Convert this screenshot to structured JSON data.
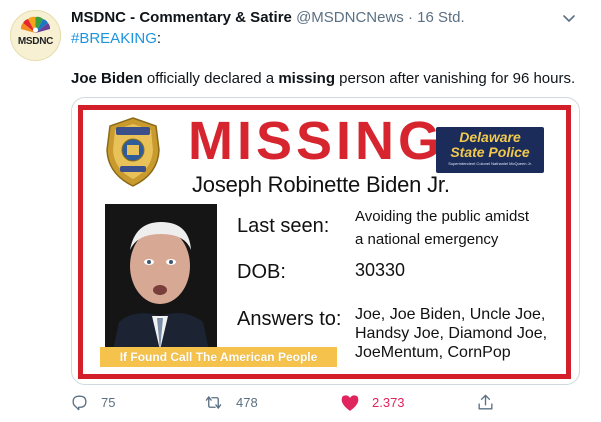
{
  "account": {
    "avatar_text": "MSDNC",
    "display_name": "MSDNC - Commentary & Satire",
    "handle": "@MSDNCNews",
    "separator": "·",
    "time": "16 Std."
  },
  "tweet": {
    "hashtag": "#BREAKING",
    "hashtag_suffix": ":",
    "text_part1": "Joe Biden",
    "text_part2": " officially declared a ",
    "text_part3": "missing",
    "text_part4": " person after vanishing for 96 hours."
  },
  "poster": {
    "headline": "MISSING",
    "name": "Joseph Robinette Biden Jr.",
    "agency_line1": "Delaware",
    "agency_line2": "State Police",
    "agency_sub": "Superintendent Colonel Nathaniel McQueen Jr.",
    "badge_top": "DELAWARE",
    "badge_bottom": "STATE POLICE",
    "last_seen_label": "Last seen:",
    "last_seen_value_1": "Avoiding the public amidst",
    "last_seen_value_2": "a national emergency",
    "dob_label": "DOB:",
    "dob_value": "30330",
    "answers_label": "Answers to:",
    "answers_value_1": "Joe, Joe Biden, Uncle Joe,",
    "answers_value_2": "Handsy Joe, Diamond Joe,",
    "answers_value_3": "JoeMentum, CornPop",
    "found_banner": "If Found Call The American People"
  },
  "actions": {
    "replies": "75",
    "retweets": "478",
    "likes": "2.373"
  },
  "colors": {
    "link": "#1b95e0",
    "like": "#e0245e",
    "poster_red": "#d6252e",
    "muted": "#5b7083"
  }
}
